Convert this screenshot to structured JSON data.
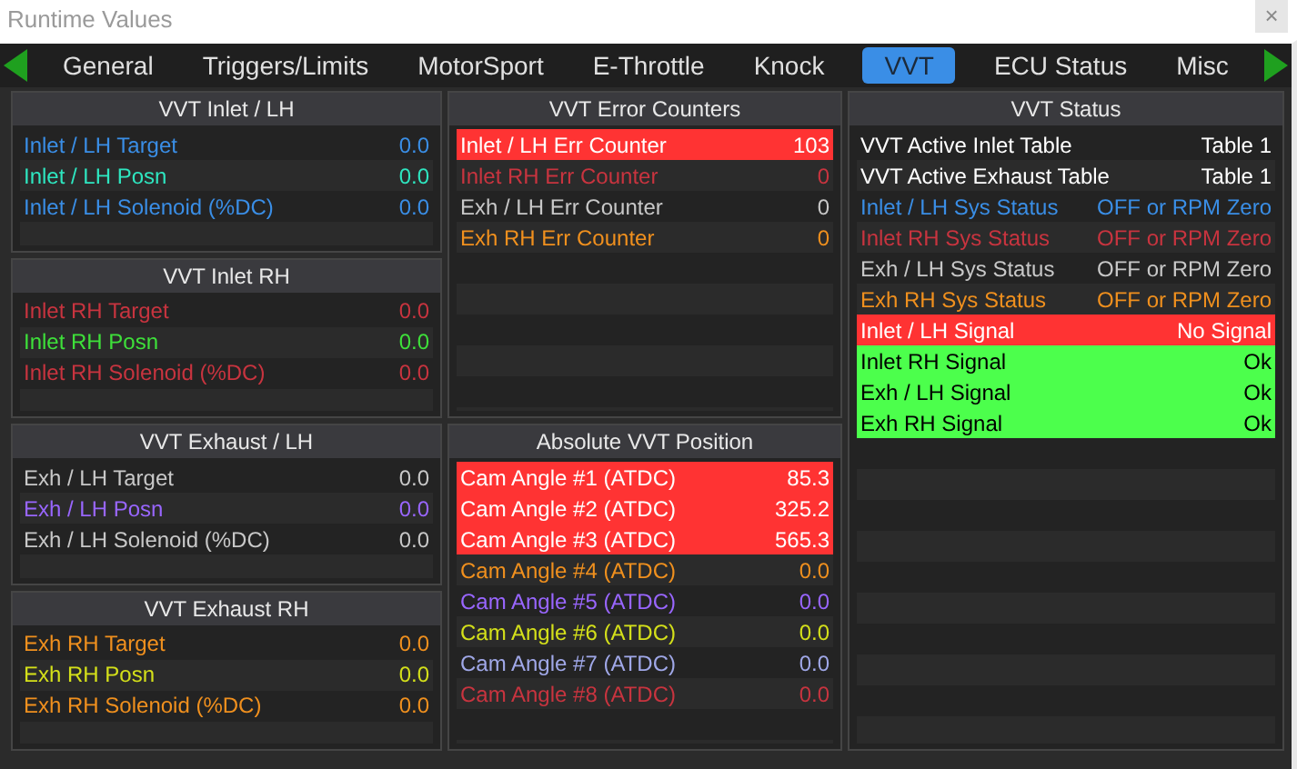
{
  "window": {
    "title": "Runtime Values",
    "close": "×"
  },
  "tabs": [
    {
      "label": "General",
      "selected": false
    },
    {
      "label": "Triggers/Limits",
      "selected": false
    },
    {
      "label": "MotorSport",
      "selected": false
    },
    {
      "label": "E-Throttle",
      "selected": false
    },
    {
      "label": "Knock",
      "selected": false
    },
    {
      "label": "VVT",
      "selected": true
    },
    {
      "label": "ECU Status",
      "selected": false
    },
    {
      "label": "Misc",
      "selected": false
    }
  ],
  "columns": [
    [
      {
        "title": "VVT Inlet / LH",
        "rows": [
          {
            "kind": "plain",
            "label": "Inlet / LH Target",
            "value": "0.0",
            "color": "#3a8ee6"
          },
          {
            "kind": "plain",
            "label": "Inlet / LH Posn",
            "value": "0.0",
            "color": "#2ee6c0"
          },
          {
            "kind": "plain",
            "label": "Inlet / LH Solenoid (%DC)",
            "value": "0.0",
            "color": "#3a8ee6"
          }
        ]
      },
      {
        "title": "VVT Inlet RH",
        "rows": [
          {
            "kind": "plain",
            "label": "Inlet RH Target",
            "value": "0.0",
            "color": "#c8343f"
          },
          {
            "kind": "plain",
            "label": "Inlet RH Posn",
            "value": "0.0",
            "color": "#3ee03a"
          },
          {
            "kind": "plain",
            "label": "Inlet RH Solenoid (%DC)",
            "value": "0.0",
            "color": "#c8343f"
          }
        ]
      },
      {
        "title": "VVT Exhaust / LH",
        "rows": [
          {
            "kind": "plain",
            "label": "Exh / LH Target",
            "value": "0.0",
            "color": "#c8c8c8"
          },
          {
            "kind": "plain",
            "label": "Exh / LH Posn",
            "value": "0.0",
            "color": "#9966ff"
          },
          {
            "kind": "plain",
            "label": "Exh / LH Solenoid (%DC)",
            "value": "0.0",
            "color": "#c8c8c8"
          }
        ]
      },
      {
        "title": "VVT Exhaust RH",
        "rows": [
          {
            "kind": "plain",
            "label": "Exh RH Target",
            "value": "0.0",
            "color": "#f0901e"
          },
          {
            "kind": "plain",
            "label": "Exh RH Posn",
            "value": "0.0",
            "color": "#d4e01a"
          },
          {
            "kind": "plain",
            "label": "Exh RH Solenoid (%DC)",
            "value": "0.0",
            "color": "#f0901e"
          }
        ]
      }
    ],
    [
      {
        "title": "VVT Error Counters",
        "rows": [
          {
            "kind": "alarm",
            "label": "Inlet / LH Err Counter",
            "value": "103"
          },
          {
            "kind": "plain",
            "label": "Inlet RH Err Counter",
            "value": "0",
            "color": "#c8343f"
          },
          {
            "kind": "plain",
            "label": "Exh / LH Err Counter",
            "value": "0",
            "color": "#c8c8c8"
          },
          {
            "kind": "plain",
            "label": "Exh RH Err Counter",
            "value": "0",
            "color": "#f0901e"
          }
        ]
      },
      {
        "title": "Absolute VVT Position",
        "rows": [
          {
            "kind": "alarm",
            "label": "Cam Angle #1 (ATDC)",
            "value": "85.3"
          },
          {
            "kind": "alarm",
            "label": "Cam Angle #2 (ATDC)",
            "value": "325.2"
          },
          {
            "kind": "alarm",
            "label": "Cam Angle #3 (ATDC)",
            "value": "565.3"
          },
          {
            "kind": "plain",
            "label": "Cam Angle #4 (ATDC)",
            "value": "0.0",
            "color": "#f0901e"
          },
          {
            "kind": "plain",
            "label": "Cam Angle #5 (ATDC)",
            "value": "0.0",
            "color": "#9966ff"
          },
          {
            "kind": "plain",
            "label": "Cam Angle #6 (ATDC)",
            "value": "0.0",
            "color": "#d4e01a"
          },
          {
            "kind": "plain",
            "label": "Cam Angle #7 (ATDC)",
            "value": "0.0",
            "color": "#a0a8e8"
          },
          {
            "kind": "plain",
            "label": "Cam Angle #8 (ATDC)",
            "value": "0.0",
            "color": "#c8343f"
          }
        ]
      }
    ],
    [
      {
        "title": "VVT Status",
        "rows": [
          {
            "kind": "plain",
            "label": "VVT Active Inlet Table",
            "value": "Table 1",
            "color": "#ffffff"
          },
          {
            "kind": "plain",
            "label": "VVT Active Exhaust Table",
            "value": "Table 1",
            "color": "#ffffff"
          },
          {
            "kind": "plain",
            "label": "Inlet / LH Sys Status",
            "value": "OFF or RPM Zero",
            "color": "#3a8ee6"
          },
          {
            "kind": "plain",
            "label": "Inlet RH Sys Status",
            "value": "OFF or RPM Zero",
            "color": "#c8343f"
          },
          {
            "kind": "plain",
            "label": "Exh / LH Sys Status",
            "value": "OFF or RPM Zero",
            "color": "#c8c8c8"
          },
          {
            "kind": "plain",
            "label": "Exh RH Sys Status",
            "value": "OFF or RPM Zero",
            "color": "#f0901e"
          },
          {
            "kind": "alarm",
            "label": "Inlet / LH Signal",
            "value": "No Signal"
          },
          {
            "kind": "ok",
            "label": "Inlet RH Signal",
            "value": "Ok"
          },
          {
            "kind": "ok",
            "label": "Exh / LH Signal",
            "value": "Ok"
          },
          {
            "kind": "ok",
            "label": "Exh RH Signal",
            "value": "Ok"
          }
        ]
      }
    ]
  ]
}
